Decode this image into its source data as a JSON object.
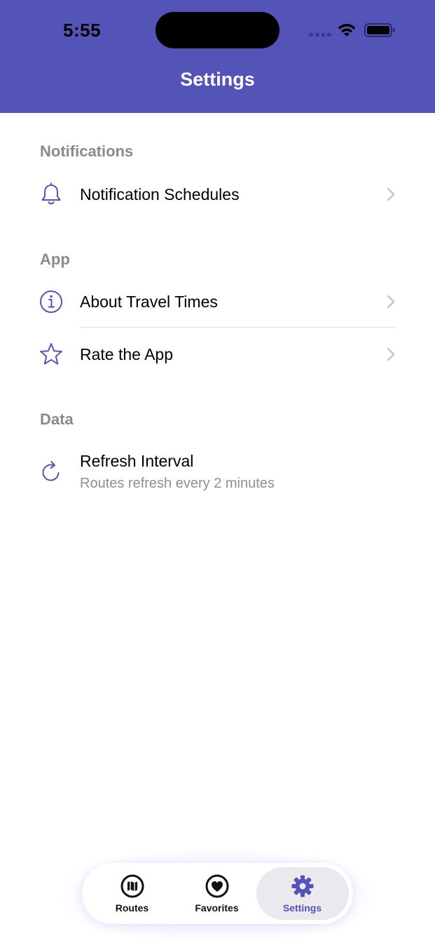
{
  "status_bar": {
    "time": "5:55"
  },
  "header": {
    "title": "Settings"
  },
  "sections": [
    {
      "title": "Notifications",
      "items": [
        {
          "label": "Notification Schedules",
          "icon": "bell-icon"
        }
      ]
    },
    {
      "title": "App",
      "items": [
        {
          "label": "About Travel Times",
          "icon": "info-icon"
        },
        {
          "label": "Rate the App",
          "icon": "star-icon"
        }
      ]
    },
    {
      "title": "Data",
      "items": [
        {
          "label": "Refresh Interval",
          "subtitle": "Routes refresh every 2 minutes",
          "icon": "refresh-icon"
        }
      ]
    }
  ],
  "tab_bar": {
    "tabs": [
      {
        "label": "Routes",
        "icon": "map-icon",
        "selected": false
      },
      {
        "label": "Favorites",
        "icon": "heart-icon",
        "selected": false
      },
      {
        "label": "Settings",
        "icon": "gear-icon",
        "selected": true
      }
    ]
  },
  "colors": {
    "accent": "#5454B8",
    "section_header": "#8a8a8e",
    "chevron": "#c4c4c8"
  }
}
